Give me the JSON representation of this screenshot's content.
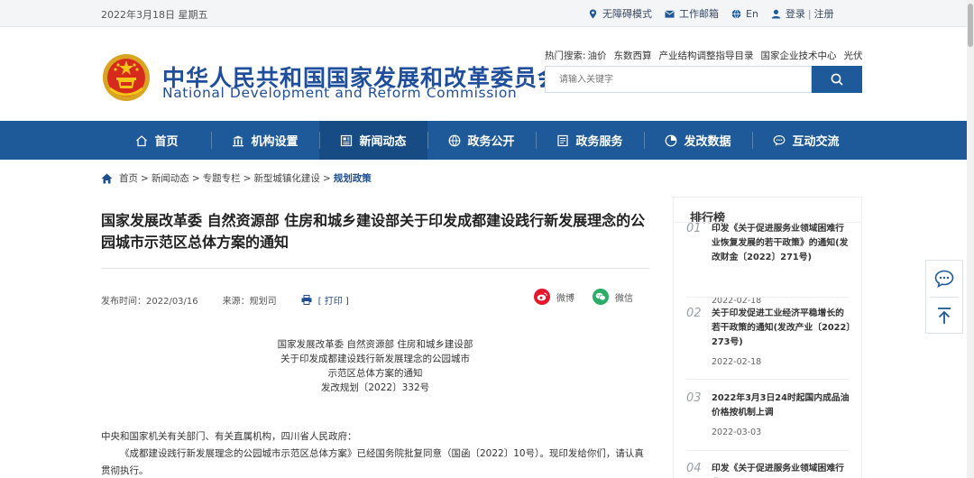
{
  "topbar": {
    "date": "2022年3月18日 星期五",
    "accessibility": "无障碍模式",
    "mailbox": "工作邮箱",
    "lang": "En",
    "login": "登录",
    "sep": "|",
    "register": "注册"
  },
  "header": {
    "title_cn": "中华人民共和国国家发展和改革委员会",
    "title_en": "National Development and Reform Commission",
    "hot_label": "热门搜索:",
    "hot_terms": [
      "油价",
      "东数西算",
      "产业结构调整指导目录",
      "国家企业技术中心",
      "光伏"
    ],
    "search_placeholder": "请输入关键字"
  },
  "nav": {
    "items": [
      {
        "label": "首页",
        "icon": "home-icon"
      },
      {
        "label": "机构设置",
        "icon": "building-icon"
      },
      {
        "label": "新闻动态",
        "icon": "news-icon"
      },
      {
        "label": "政务公开",
        "icon": "globe-icon"
      },
      {
        "label": "政务服务",
        "icon": "document-icon"
      },
      {
        "label": "发改数据",
        "icon": "pie-chart-icon"
      },
      {
        "label": "互动交流",
        "icon": "chat-icon"
      }
    ],
    "active_index": 2
  },
  "breadcrumb": {
    "items": [
      "首页",
      "新闻动态",
      "专题专栏",
      "新型城镇化建设"
    ],
    "current": "规划政策",
    "sep": ">"
  },
  "article": {
    "title": "国家发展改革委 自然资源部 住房和城乡建设部关于印发成都建设践行新发展理念的公园城市示范区总体方案的通知",
    "published": "发布时间：2022/03/16",
    "source": "来源：规划司",
    "print": "[ 打印 ]",
    "share_weibo": "微博",
    "share_wechat": "微信",
    "head_lines": [
      "国家发展改革委 自然资源部 住房和城乡建设部",
      "关于印发成都建设践行新发展理念的公园城市",
      "示范区总体方案的通知",
      "发改规划〔2022〕332号"
    ],
    "body_p1": "中央和国家机关有关部门、有关直属机构，四川省人民政府：",
    "body_p2": "《成都建设践行新发展理念的公园城市示范区总体方案》已经国务院批复同意（国函〔2022〕10号）。现印发给你们，请认真贯彻执行。"
  },
  "ranking": {
    "title": "排行榜",
    "items": [
      {
        "num": "01",
        "text": "印发《关于促进服务业领域困难行业恢复发展的若干政策》的通知(发改财金〔2022〕271号)",
        "date": "2022-02-18"
      },
      {
        "num": "02",
        "text": "关于印发促进工业经济平稳增长的若干政策的通知(发改产业〔2022〕273号)",
        "date": "2022-02-18"
      },
      {
        "num": "03",
        "text": "2022年3月3日24时起国内成品油价格按机制上调",
        "date": "2022-03-03"
      },
      {
        "num": "04",
        "text": "印发《关于促进服务业领域困难行业",
        "date": ""
      }
    ]
  },
  "colors": {
    "brand_blue": "#1e5a99",
    "nav_active": "#174b83",
    "title_blue": "#1f4e9c",
    "weibo_red": "#e6162d",
    "wechat_green": "#2aae67"
  }
}
